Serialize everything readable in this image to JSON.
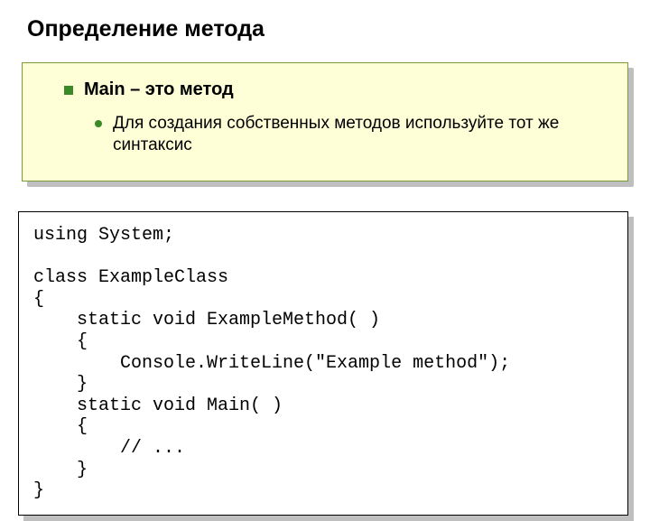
{
  "title": "Определение метода",
  "bullet": {
    "label": "Main – это метод"
  },
  "sub": {
    "text": "Для создания собственных методов используйте тот же синтаксис"
  },
  "code": {
    "l1": "using System;",
    "l2": "",
    "l3": "class ExampleClass",
    "l4": "{",
    "l5": "    static void ExampleMethod( )",
    "l6": "    {",
    "l7": "        Console.WriteLine(\"Example method\");",
    "l8": "    }",
    "l9": "    static void Main( )",
    "l10": "    {",
    "l11": "        // ...",
    "l12": "    }",
    "l13": "}"
  }
}
